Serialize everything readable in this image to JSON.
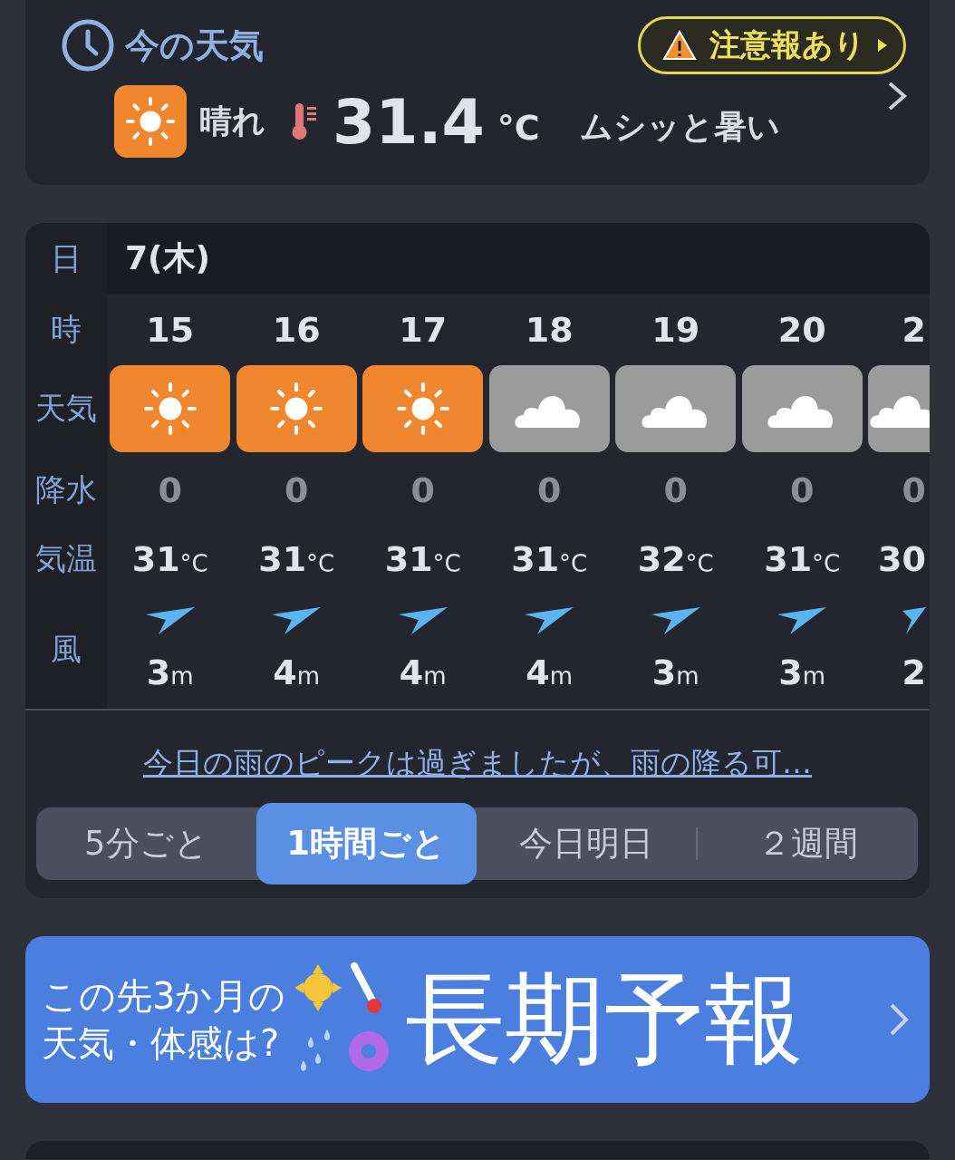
{
  "now": {
    "title": "今の天気",
    "alert": "注意報あり",
    "condition": {
      "kind": "sunny",
      "label": "晴れ"
    },
    "temperature": "31.4",
    "temp_unit": "°C",
    "feel": "ムシッと暑い"
  },
  "forecast": {
    "row_labels": {
      "day": "日",
      "hour": "時",
      "weather": "天気",
      "precip": "降水",
      "temp": "気温",
      "wind": "風"
    },
    "day": "7(木)",
    "columns": [
      {
        "partial": false,
        "hour": "15",
        "kind": "sunny",
        "precip": "0",
        "temp": "31",
        "temp_unit": "°C",
        "wind": "3",
        "wind_unit": "m"
      },
      {
        "partial": false,
        "hour": "16",
        "kind": "sunny",
        "precip": "0",
        "temp": "31",
        "temp_unit": "°C",
        "wind": "4",
        "wind_unit": "m"
      },
      {
        "partial": false,
        "hour": "17",
        "kind": "sunny",
        "precip": "0",
        "temp": "31",
        "temp_unit": "°C",
        "wind": "4",
        "wind_unit": "m"
      },
      {
        "partial": false,
        "hour": "18",
        "kind": "cloudy",
        "precip": "0",
        "temp": "31",
        "temp_unit": "°C",
        "wind": "4",
        "wind_unit": "m"
      },
      {
        "partial": false,
        "hour": "19",
        "kind": "cloudy",
        "precip": "0",
        "temp": "32",
        "temp_unit": "°C",
        "wind": "3",
        "wind_unit": "m"
      },
      {
        "partial": false,
        "hour": "20",
        "kind": "cloudy",
        "precip": "0",
        "temp": "31",
        "temp_unit": "°C",
        "wind": "3",
        "wind_unit": "m"
      },
      {
        "partial": true,
        "hour": "2",
        "kind": "cloudy",
        "precip": "0",
        "temp": "30",
        "wind": "2"
      }
    ],
    "note": "今日の雨のピークは過ぎましたが、雨の降る可…",
    "tabs": [
      {
        "label": "5分ごと",
        "selected": false
      },
      {
        "label": "1時間ごと",
        "selected": true
      },
      {
        "label": "今日明日",
        "selected": false
      },
      {
        "label": "２週間",
        "selected": false
      }
    ]
  },
  "banner": {
    "lines": [
      "この先3か月の",
      "天気・体感は?"
    ],
    "title": "長期予報"
  }
}
